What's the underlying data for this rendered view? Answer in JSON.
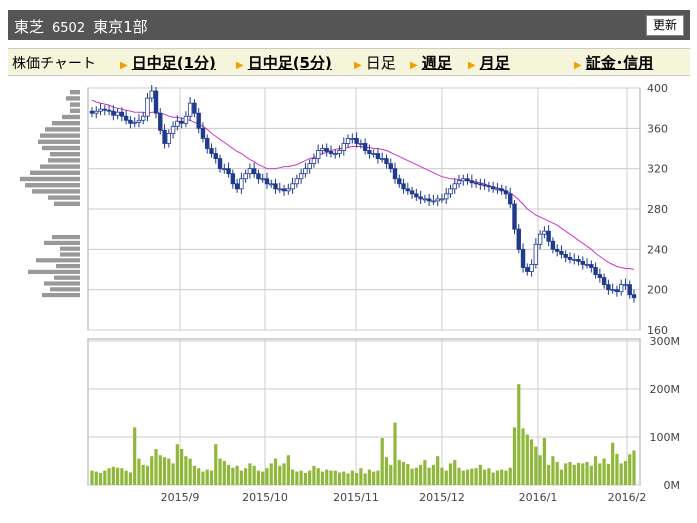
{
  "header": {
    "name": "東芝",
    "code": "6502",
    "market": "東京1部",
    "refresh_label": "更新"
  },
  "tabs": {
    "label": "株価チャート",
    "items": [
      "日中足(1分)",
      "日中足(5分)",
      "日足",
      "週足",
      "月足",
      "証金･信用"
    ],
    "active": "日足"
  },
  "colors": {
    "up": "#ffffff",
    "down": "#1f3a8f",
    "ma": "#cc33cc",
    "volume": "#8fb83a",
    "grid": "#cccccc"
  },
  "chart_data": [
    {
      "type": "candlestick",
      "title": "",
      "y_ticks": [
        "400",
        "360",
        "320",
        "280",
        "240",
        "200",
        "160"
      ],
      "ylim": [
        160,
        400
      ],
      "x_ticks": [
        "2015/9",
        "2015/10",
        "2015/11",
        "2015/12",
        "2016/1",
        "2016/2"
      ],
      "close": [
        375,
        377,
        379,
        378,
        377,
        373,
        376,
        372,
        368,
        365,
        366,
        368,
        372,
        390,
        397,
        375,
        358,
        345,
        355,
        362,
        367,
        365,
        372,
        385,
        375,
        360,
        350,
        340,
        335,
        330,
        320,
        320,
        315,
        305,
        300,
        310,
        315,
        320,
        315,
        310,
        310,
        305,
        305,
        300,
        300,
        298,
        300,
        305,
        310,
        315,
        320,
        325,
        330,
        338,
        340,
        337,
        335,
        335,
        338,
        345,
        350,
        350,
        345,
        345,
        338,
        335,
        335,
        330,
        330,
        325,
        320,
        310,
        305,
        300,
        298,
        295,
        292,
        290,
        290,
        288,
        288,
        290,
        290,
        295,
        300,
        305,
        308,
        310,
        308,
        306,
        305,
        304,
        303,
        302,
        300,
        300,
        298,
        295,
        285,
        260,
        240,
        222,
        218,
        225,
        245,
        255,
        258,
        248,
        240,
        238,
        235,
        232,
        230,
        230,
        228,
        225,
        225,
        222,
        215,
        212,
        205,
        200,
        200,
        198,
        205,
        205,
        195,
        192
      ],
      "ma": [
        388,
        386,
        385,
        384,
        383,
        381,
        380,
        379,
        378,
        377,
        376,
        376,
        376,
        375,
        376,
        376,
        375,
        374,
        372,
        371,
        371,
        370,
        369,
        368,
        366,
        364,
        362,
        359,
        355,
        352,
        349,
        346,
        343,
        340,
        337,
        335,
        332,
        329,
        327,
        324,
        322,
        320,
        320,
        320,
        321,
        322,
        322,
        323,
        324,
        326,
        328,
        330,
        331,
        333,
        335,
        336,
        338,
        339,
        340,
        340,
        341,
        342,
        342,
        342,
        341,
        341,
        340,
        340,
        339,
        338,
        336,
        334,
        332,
        330,
        328,
        326,
        324,
        322,
        320,
        318,
        316,
        314,
        312,
        311,
        310,
        310,
        309,
        309,
        308,
        308,
        307,
        306,
        305,
        303,
        302,
        301,
        300,
        298,
        296,
        293,
        289,
        285,
        280,
        277,
        274,
        272,
        270,
        268,
        266,
        264,
        261,
        258,
        255,
        252,
        249,
        246,
        243,
        240,
        236,
        233,
        230,
        227,
        225,
        223,
        222,
        221,
        221,
        220
      ],
      "volume_ticks": [
        "300M",
        "200M",
        "100M",
        "0M"
      ],
      "volume_max": 300,
      "volume": [
        30,
        28,
        25,
        30,
        35,
        38,
        36,
        35,
        30,
        26,
        120,
        55,
        42,
        40,
        60,
        75,
        62,
        58,
        55,
        45,
        85,
        75,
        60,
        55,
        40,
        35,
        28,
        32,
        30,
        85,
        55,
        50,
        42,
        36,
        40,
        30,
        35,
        45,
        40,
        30,
        28,
        35,
        45,
        55,
        40,
        45,
        62,
        32,
        28,
        30,
        25,
        30,
        40,
        35,
        28,
        32,
        30,
        30,
        26,
        28,
        24,
        30,
        25,
        35,
        24,
        32,
        28,
        30,
        98,
        58,
        42,
        130,
        52,
        48,
        44,
        34,
        36,
        42,
        52,
        36,
        42,
        60,
        36,
        30,
        45,
        52,
        36,
        30,
        32,
        34,
        35,
        42,
        32,
        35,
        26,
        30,
        32,
        30,
        36,
        120,
        210,
        118,
        105,
        95,
        80,
        62,
        98,
        42,
        60,
        48,
        32,
        45,
        48,
        42,
        46,
        45,
        48,
        40,
        60,
        45,
        55,
        44,
        88,
        65,
        45,
        50,
        64,
        72
      ]
    }
  ],
  "side_profile": {
    "upper": [
      10,
      14,
      10,
      10,
      18,
      28,
      35,
      40,
      42,
      38,
      30,
      32,
      40,
      50,
      60,
      55,
      48,
      32,
      26
    ],
    "lower": [
      28,
      36,
      20,
      20,
      44,
      24,
      52,
      26,
      36,
      30,
      38
    ]
  }
}
